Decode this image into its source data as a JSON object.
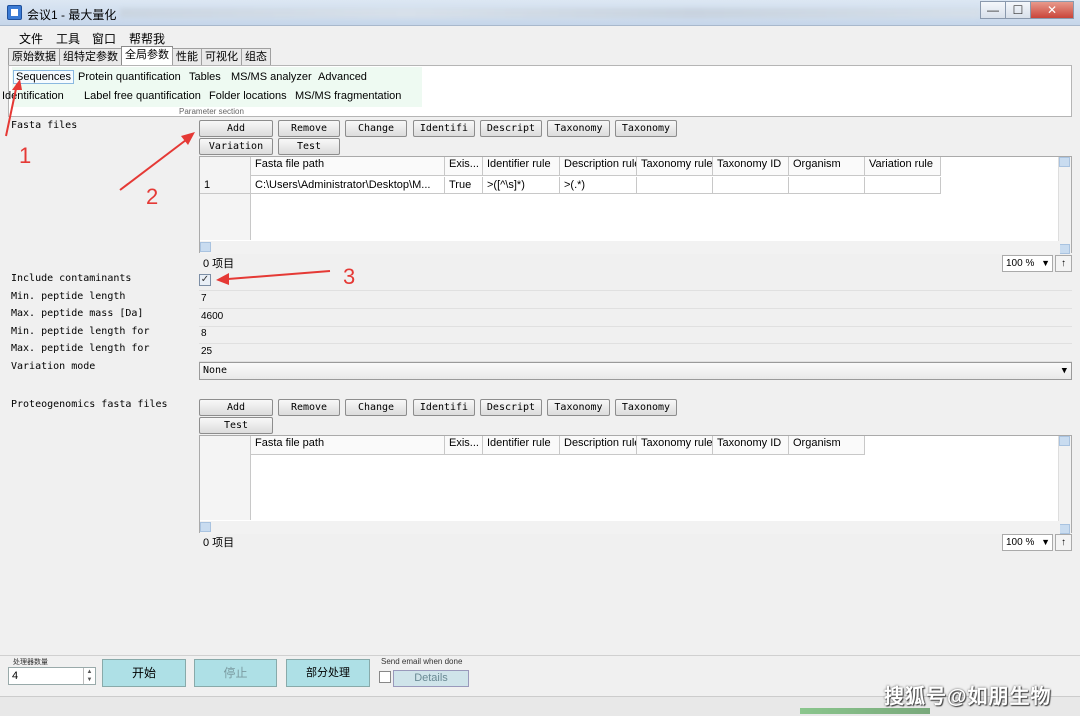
{
  "window": {
    "title": "会议1 - 最大量化",
    "controls": [
      "—",
      "☐",
      "✕"
    ]
  },
  "menu": [
    "文件",
    "工具",
    "窗口",
    "帮帮我"
  ],
  "tabs": [
    "原始数据",
    "组特定参数",
    "全局参数",
    "性能",
    "可视化",
    "组态"
  ],
  "active_tab": 2,
  "param_section": {
    "row1": [
      "Sequences",
      "Protein quantification",
      "Tables",
      "MS/MS analyzer",
      "Advanced"
    ],
    "row2": [
      "Identification",
      "Label free quantification",
      "Folder locations",
      "MS/MS fragmentation"
    ],
    "caption": "Parameter section"
  },
  "fasta": {
    "label": "Fasta files",
    "buttons_row1": [
      "Add",
      "Remove",
      "Change",
      "Identifi",
      "Descript",
      "Taxonomy",
      "Taxonomy"
    ],
    "buttons_row2": [
      "Variation",
      "Test"
    ],
    "columns": [
      "Fasta file path",
      "Exis...",
      "Identifier rule",
      "Description rule",
      "Taxonomy rule",
      "Taxonomy ID",
      "Organism",
      "Variation rule"
    ],
    "rows": [
      {
        "index": "1",
        "path": "C:\\Users\\Administrator\\Desktop\\M...",
        "exists": "True",
        "identifier": ">([^\\s]*)",
        "description": ">(.*)",
        "taxonomy_rule": "",
        "taxonomy_id": "",
        "organism": "",
        "variation": ""
      }
    ],
    "count": "0 项目",
    "zoom": "100 %"
  },
  "fields": {
    "include_contaminants": {
      "label": "Include contaminants",
      "checked": true
    },
    "min_peptide_length": {
      "label": "Min. peptide length",
      "value": "7"
    },
    "max_peptide_mass": {
      "label": "Max. peptide mass [Da]",
      "value": "4600"
    },
    "min_peptide_length_for": {
      "label": "Min. peptide length for",
      "value": "8"
    },
    "max_peptide_length_for": {
      "label": "Max. peptide length for",
      "value": "25"
    },
    "variation_mode": {
      "label": "Variation mode",
      "value": "None"
    }
  },
  "proteogenomics": {
    "label": "Proteogenomics fasta files",
    "buttons_row1": [
      "Add",
      "Remove",
      "Change",
      "Identifi",
      "Descript",
      "Taxonomy",
      "Taxonomy"
    ],
    "buttons_row2": [
      "Test"
    ],
    "columns": [
      "Fasta file path",
      "Exis...",
      "Identifier rule",
      "Description rule",
      "Taxonomy rule",
      "Taxonomy ID",
      "Organism"
    ],
    "count": "0 项目",
    "zoom": "100 %"
  },
  "bottom": {
    "processors_label": "处理器数量",
    "processors_value": "4",
    "start": "开始",
    "stop": "停止",
    "partial": "部分处理",
    "email_label": "Send email when done",
    "details": "Details"
  },
  "watermark": "搜狐号@如朋生物",
  "annotations": [
    "1",
    "2",
    "3"
  ],
  "colors": {
    "annotation": "#e53935",
    "button_accent": "#aee0e6",
    "param_bg": "#eefaf2"
  }
}
